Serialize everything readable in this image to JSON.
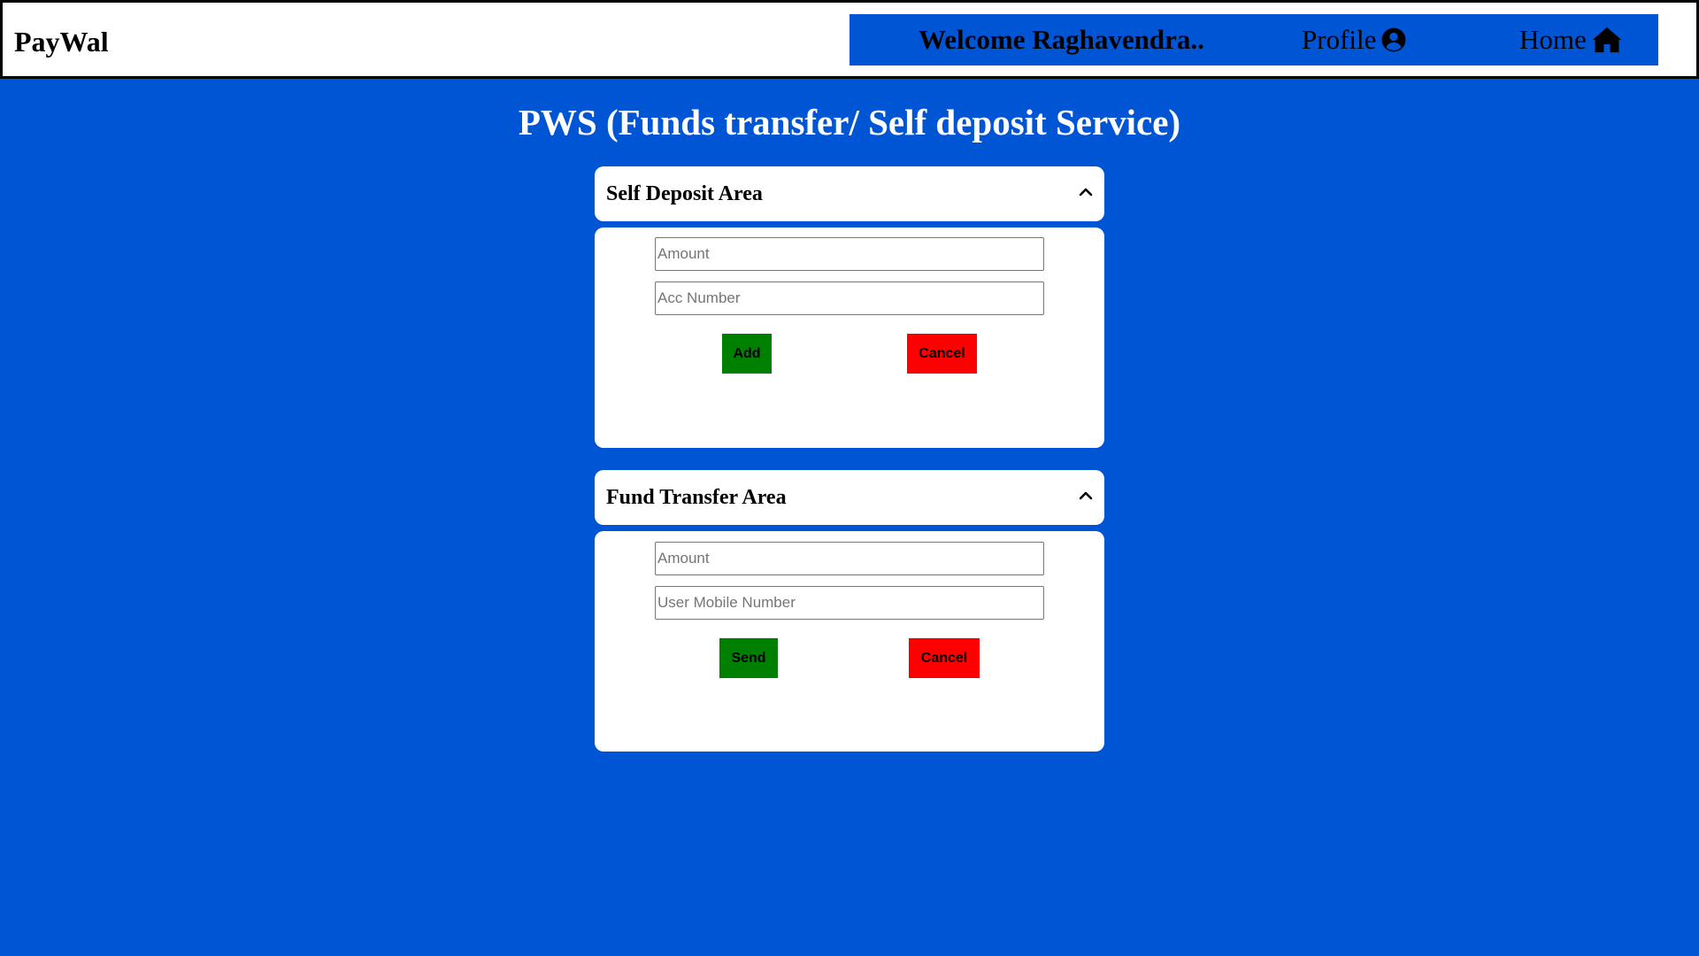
{
  "header": {
    "brand": "PayWal",
    "welcome": "Welcome Raghavendra..",
    "profile_label": "Profile",
    "home_label": "Home",
    "profile_icon": "user-circle-icon",
    "home_icon": "home-icon"
  },
  "page_title": "PWS (Funds transfer/ Self deposit Service)",
  "self_deposit": {
    "title": "Self Deposit Area",
    "amount_placeholder": "Amount",
    "account_placeholder": "Acc Number",
    "submit_label": "Add",
    "cancel_label": "Cancel"
  },
  "fund_transfer": {
    "title": "Fund Transfer Area",
    "amount_placeholder": "Amount",
    "mobile_placeholder": "User Mobile Number",
    "submit_label": "Send",
    "cancel_label": "Cancel"
  },
  "colors": {
    "background": "#0055d4",
    "submit": "#008000",
    "cancel": "#ff0000"
  }
}
